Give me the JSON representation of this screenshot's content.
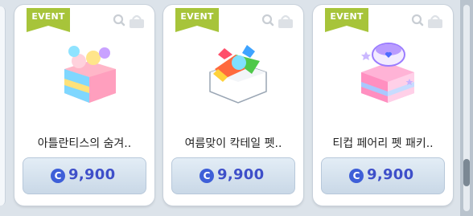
{
  "items": [
    {
      "badge": "EVENT",
      "name": "아틀란티스의 숨겨..",
      "price": "9,900",
      "currency_icon": "cash-coin-icon"
    },
    {
      "badge": "EVENT",
      "name": "여름맞이 칵테일 펫..",
      "price": "9,900",
      "currency_icon": "cash-coin-icon"
    },
    {
      "badge": "EVENT",
      "name": "티컵 페어리 펫 패키..",
      "price": "9,900",
      "currency_icon": "cash-coin-icon"
    }
  ],
  "colors": {
    "badge": "#a7c43a",
    "price_text": "#3e4fc9",
    "coin": "#3e5fd8"
  }
}
